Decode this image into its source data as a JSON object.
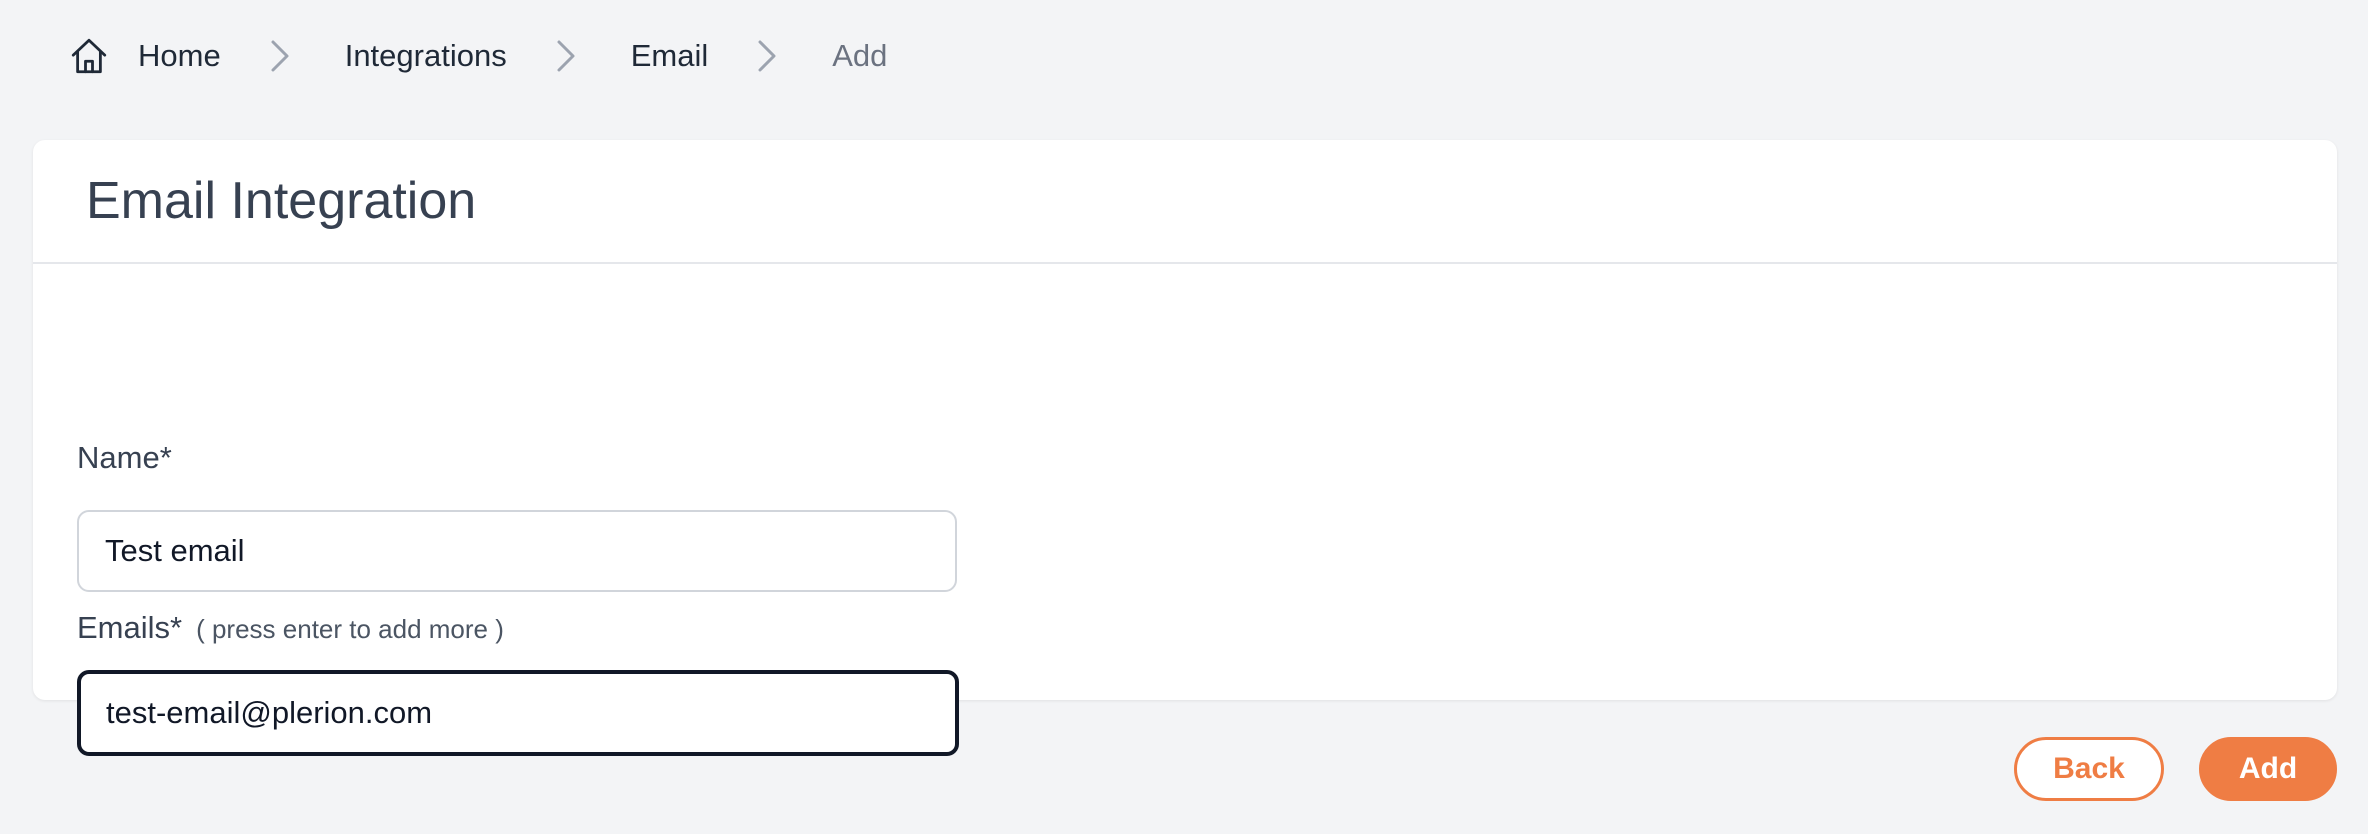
{
  "breadcrumb": {
    "home_icon": "home-icon",
    "items": [
      {
        "label": "Home"
      },
      {
        "label": "Integrations"
      },
      {
        "label": "Email"
      },
      {
        "label": "Add"
      }
    ],
    "separator_icon": "chevron-right-icon"
  },
  "card": {
    "title": "Email Integration"
  },
  "form": {
    "name_label": "Name*",
    "name_value": "Test email",
    "emails_label": "Emails*",
    "emails_hint": "( press enter to add more )",
    "emails_value": "test-email@plerion.com"
  },
  "actions": {
    "back_label": "Back",
    "add_label": "Add"
  },
  "colors": {
    "accent": "#ef7d44",
    "background": "#f3f4f6",
    "focus_border": "#111827"
  }
}
